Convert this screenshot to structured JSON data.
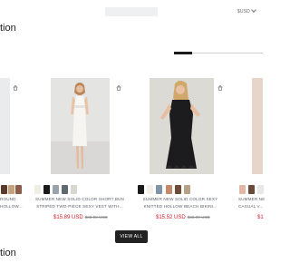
{
  "header": {
    "currency": "$USD"
  },
  "sections": {
    "top_title_fragment": "tion",
    "bottom_title_fragment": "tion"
  },
  "carousel": {
    "progress": 0.2
  },
  "products": [
    {
      "name_lines": [
        "ROUND",
        "HOLLOW..."
      ],
      "price_sale": "",
      "price_old": "",
      "swatch_colors": [
        "#5a3a2a",
        "#c6a17e",
        "#8b5e4a"
      ]
    },
    {
      "name_lines": [
        "SUMMER NEW SOLID COLOR SHORT BUN",
        "STRIPED TWO-PIECE SEXY VEST WITH..."
      ],
      "price_sale": "$15.89 USD",
      "price_old": "$33.98 USD",
      "swatch_colors": [
        "#f1ede5",
        "#1a1a1a",
        "#9aa3ab",
        "#5e6a70",
        "#d8d6cf"
      ]
    },
    {
      "name_lines": [
        "SUMMER NEW SOLID COLOR SEXY",
        "KNITTED HOLLOW BEACH BIKINI..."
      ],
      "price_sale": "$15.52 USD",
      "price_old": "$33.98 USD",
      "swatch_colors": [
        "#1a1a1a",
        "#f3f0ea",
        "#7f95a7",
        "#c48a6a",
        "#6d4b36",
        "#b7a287"
      ]
    },
    {
      "name_lines": [
        "SUMMER NE",
        "CASUAL V..."
      ],
      "price_sale": "$1",
      "price_old": "",
      "swatch_colors": [
        "#e2b8a4",
        "#6a4a3a",
        "#e8e8e8"
      ]
    }
  ],
  "buttons": {
    "view_all": "VIEW ALL"
  },
  "icons": {
    "bag": "shopping-bag-icon",
    "chevron": "chevron-down-icon"
  }
}
